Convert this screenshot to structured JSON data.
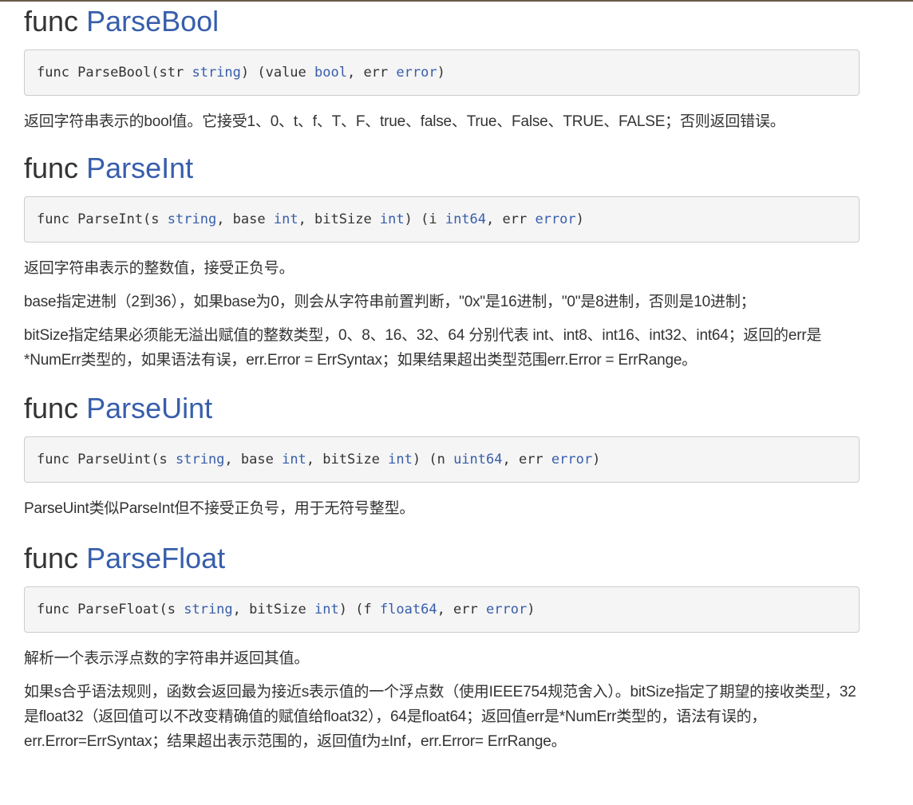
{
  "sections": [
    {
      "heading_kw": "func",
      "heading_name": "ParseBool",
      "signature": [
        {
          "text": "func ParseBool(str ",
          "type": false
        },
        {
          "text": "string",
          "type": true
        },
        {
          "text": ") (value ",
          "type": false
        },
        {
          "text": "bool",
          "type": true
        },
        {
          "text": ", err ",
          "type": false
        },
        {
          "text": "error",
          "type": true
        },
        {
          "text": ")",
          "type": false
        }
      ],
      "paragraphs": [
        "返回字符串表示的bool值。它接受1、0、t、f、T、F、true、false、True、False、TRUE、FALSE；否则返回错误。"
      ]
    },
    {
      "heading_kw": "func",
      "heading_name": "ParseInt",
      "signature": [
        {
          "text": "func ParseInt(s ",
          "type": false
        },
        {
          "text": "string",
          "type": true
        },
        {
          "text": ", base ",
          "type": false
        },
        {
          "text": "int",
          "type": true
        },
        {
          "text": ", bitSize ",
          "type": false
        },
        {
          "text": "int",
          "type": true
        },
        {
          "text": ") (i ",
          "type": false
        },
        {
          "text": "int64",
          "type": true
        },
        {
          "text": ", err ",
          "type": false
        },
        {
          "text": "error",
          "type": true
        },
        {
          "text": ")",
          "type": false
        }
      ],
      "paragraphs": [
        "返回字符串表示的整数值，接受正负号。",
        "base指定进制（2到36），如果base为0，则会从字符串前置判断，\"0x\"是16进制，\"0\"是8进制，否则是10进制；",
        "bitSize指定结果必须能无溢出赋值的整数类型，0、8、16、32、64 分别代表 int、int8、int16、int32、int64；返回的err是*NumErr类型的，如果语法有误，err.Error = ErrSyntax；如果结果超出类型范围err.Error = ErrRange。"
      ]
    },
    {
      "heading_kw": "func",
      "heading_name": "ParseUint",
      "signature": [
        {
          "text": "func ParseUint(s ",
          "type": false
        },
        {
          "text": "string",
          "type": true
        },
        {
          "text": ", base ",
          "type": false
        },
        {
          "text": "int",
          "type": true
        },
        {
          "text": ", bitSize ",
          "type": false
        },
        {
          "text": "int",
          "type": true
        },
        {
          "text": ") (n ",
          "type": false
        },
        {
          "text": "uint64",
          "type": true
        },
        {
          "text": ", err ",
          "type": false
        },
        {
          "text": "error",
          "type": true
        },
        {
          "text": ")",
          "type": false
        }
      ],
      "paragraphs": [
        "ParseUint类似ParseInt但不接受正负号，用于无符号整型。"
      ]
    },
    {
      "heading_kw": "func",
      "heading_name": "ParseFloat",
      "signature": [
        {
          "text": "func ParseFloat(s ",
          "type": false
        },
        {
          "text": "string",
          "type": true
        },
        {
          "text": ", bitSize ",
          "type": false
        },
        {
          "text": "int",
          "type": true
        },
        {
          "text": ") (f ",
          "type": false
        },
        {
          "text": "float64",
          "type": true
        },
        {
          "text": ", err ",
          "type": false
        },
        {
          "text": "error",
          "type": true
        },
        {
          "text": ")",
          "type": false
        }
      ],
      "paragraphs": [
        "解析一个表示浮点数的字符串并返回其值。",
        "如果s合乎语法规则，函数会返回最为接近s表示值的一个浮点数（使用IEEE754规范舍入）。bitSize指定了期望的接收类型，32是float32（返回值可以不改变精确值的赋值给float32），64是float64；返回值err是*NumErr类型的，语法有误的，err.Error=ErrSyntax；结果超出表示范围的，返回值f为±Inf，err.Error= ErrRange。"
      ]
    }
  ],
  "colors": {
    "link": "#375eab",
    "text": "#333333",
    "code_bg": "#f5f5f5",
    "code_border": "#cccccc"
  }
}
